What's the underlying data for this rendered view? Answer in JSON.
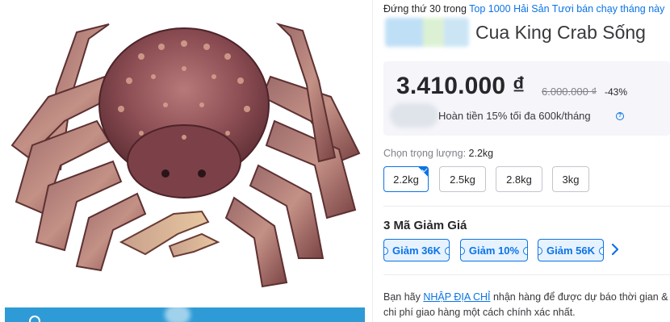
{
  "ranking": {
    "prefix": "Đứng thứ 30 trong",
    "link": "Top 1000 Hải Sản Tươi bán chạy tháng này"
  },
  "product": {
    "title": "Cua King Crab Sống",
    "image_alt": "king-crab-photo"
  },
  "price": {
    "current": "3.410.000 ₫",
    "list": "6.000.000 ₫",
    "discount": "-43%"
  },
  "cashback": {
    "text": "Hoàn tiền 15% tối đa 600k/tháng"
  },
  "weight": {
    "label": "Chọn trọng lượng: ",
    "selected": "2.2kg",
    "options": [
      "2.2kg",
      "2.5kg",
      "2.8kg",
      "3kg"
    ]
  },
  "coupons": {
    "title": "3 Mã Giảm Giá",
    "items": [
      "Giảm 36K",
      "Giảm 10%",
      "Giảm 56K"
    ]
  },
  "address": {
    "before": "Bạn hãy ",
    "link": "NHẬP ĐỊA CHỈ",
    "after": " nhận hàng để được dự báo thời gian & chi phí giao hàng một cách chính xác nhất."
  },
  "colors": {
    "accent": "#0b74e5",
    "price_box_bg": "#f5f5fa",
    "footer_bar": "#2e9bd6"
  },
  "icons": [
    "info-icon",
    "check-icon",
    "chevron-right-icon"
  ]
}
